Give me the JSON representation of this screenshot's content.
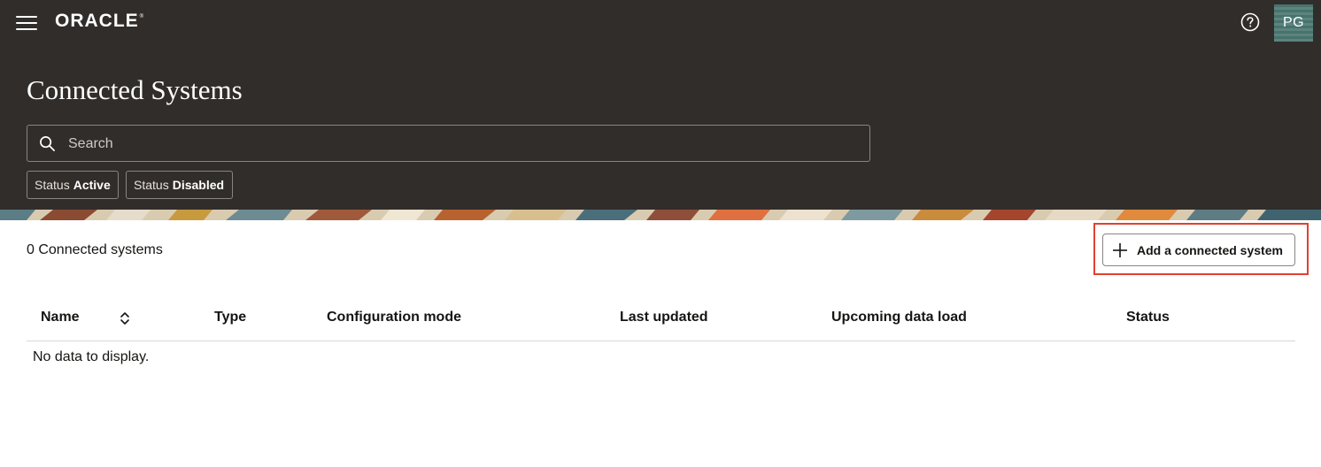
{
  "header": {
    "logo": "ORACLE",
    "logo_mark": "®",
    "avatar_initials": "PG",
    "title": "Connected Systems"
  },
  "search": {
    "placeholder": "Search",
    "value": ""
  },
  "filters": [
    {
      "label": "Status",
      "value": "Active"
    },
    {
      "label": "Status",
      "value": "Disabled"
    }
  ],
  "main": {
    "count_text": "0 Connected systems",
    "add_button_label": "Add a connected system",
    "empty_text": "No data to display."
  },
  "table": {
    "columns": [
      "Name",
      "Type",
      "Configuration mode",
      "Last updated",
      "Upcoming data load",
      "Status"
    ]
  },
  "colors": {
    "header_bg": "#312d2a",
    "highlight": "#e0412f",
    "avatar_bg": "#4d7a74"
  },
  "icons": [
    "hamburger-menu-icon",
    "help-icon",
    "search-icon",
    "plus-icon",
    "sort-icon"
  ]
}
